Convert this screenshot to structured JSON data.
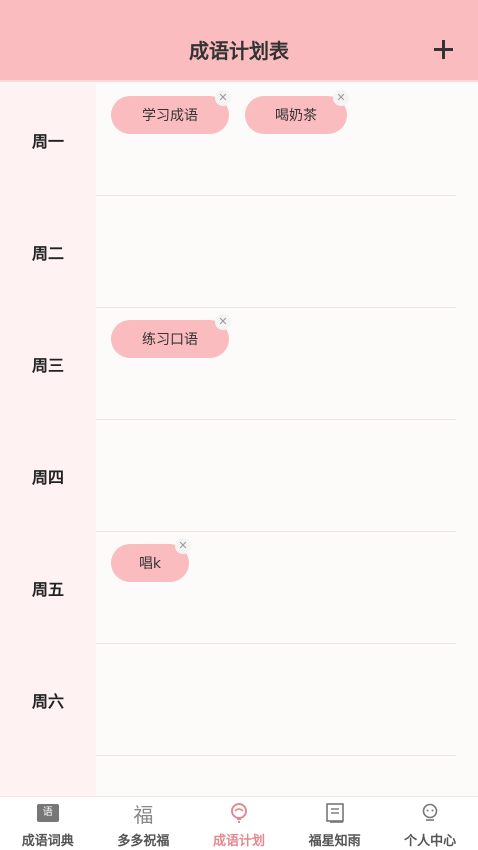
{
  "header": {
    "title": "成语计划表"
  },
  "days": [
    {
      "label": "周一",
      "tasks": [
        "学习成语",
        "喝奶茶"
      ]
    },
    {
      "label": "周二",
      "tasks": []
    },
    {
      "label": "周三",
      "tasks": [
        "练习口语"
      ]
    },
    {
      "label": "周四",
      "tasks": []
    },
    {
      "label": "周五",
      "tasks": [
        "唱k"
      ]
    },
    {
      "label": "周六",
      "tasks": []
    }
  ],
  "tabs": [
    {
      "label": "成语词典",
      "icon": "dictionary-icon",
      "glyph": "语"
    },
    {
      "label": "多多祝福",
      "icon": "blessing-icon",
      "glyph": "福"
    },
    {
      "label": "成语计划",
      "icon": "plan-icon",
      "active": true
    },
    {
      "label": "福星知雨",
      "icon": "book-icon"
    },
    {
      "label": "个人中心",
      "icon": "profile-icon"
    }
  ],
  "colors": {
    "accent": "#fbbcbf",
    "active_tab": "#e38a8f",
    "sidebar": "#fff2f2"
  }
}
